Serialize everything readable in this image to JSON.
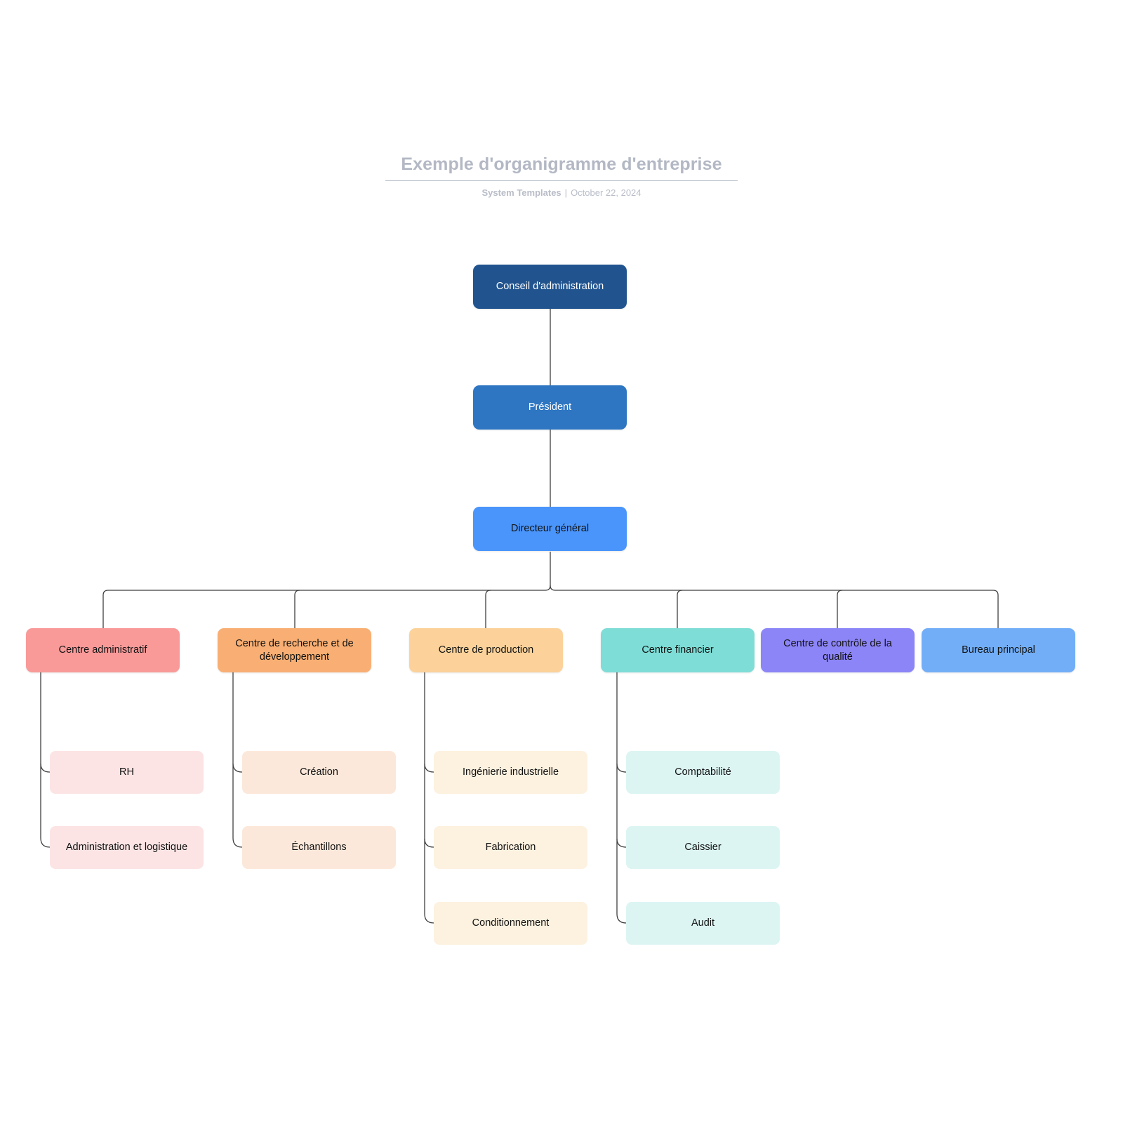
{
  "header": {
    "title": "Exemple d'organigramme d'entreprise",
    "author": "System Templates",
    "separator": "|",
    "date": "October 22, 2024"
  },
  "chart_data": {
    "type": "diagram",
    "diagram_kind": "organizational-chart",
    "title": "Exemple d'organigramme d'entreprise",
    "language": "fr",
    "levels": 4,
    "node_count": 18
  },
  "nodes": {
    "board": {
      "label": "Conseil d'administration",
      "color": "#21548F",
      "text_color": "#ffffff"
    },
    "president": {
      "label": "Président",
      "color": "#2E76C2",
      "text_color": "#ffffff"
    },
    "ceo": {
      "label": "Directeur général",
      "color": "#4A95FB",
      "text_color": "#111111"
    },
    "admin": {
      "label": "Centre administratif",
      "color": "#F99A99",
      "text_color": "#111111"
    },
    "rnd": {
      "label": "Centre de recherche et de développement",
      "color": "#F9AF73",
      "text_color": "#111111"
    },
    "production": {
      "label": "Centre de production",
      "color": "#FCD29A",
      "text_color": "#111111"
    },
    "finance": {
      "label": "Centre financier",
      "color": "#7EDDD6",
      "text_color": "#111111"
    },
    "quality": {
      "label": "Centre de contrôle de la qualité",
      "color": "#8C85F8",
      "text_color": "#111111"
    },
    "mainoffice": {
      "label": "Bureau principal",
      "color": "#72AEF8",
      "text_color": "#111111"
    },
    "hr": {
      "label": "RH",
      "color": "#FCE4E4",
      "text_color": "#111111"
    },
    "adminlog": {
      "label": "Administration et logistique",
      "color": "#FCE4E4",
      "text_color": "#111111"
    },
    "creation": {
      "label": "Création",
      "color": "#FCE8DA",
      "text_color": "#111111"
    },
    "samples": {
      "label": "Échantillons",
      "color": "#FCE8DA",
      "text_color": "#111111"
    },
    "indeng": {
      "label": "Ingénierie industrielle",
      "color": "#FDF1DF",
      "text_color": "#111111"
    },
    "manufacture": {
      "label": "Fabrication",
      "color": "#FDF1DF",
      "text_color": "#111111"
    },
    "packaging": {
      "label": "Conditionnement",
      "color": "#FDF1DF",
      "text_color": "#111111"
    },
    "accounting": {
      "label": "Comptabilité",
      "color": "#DCF5F3",
      "text_color": "#111111"
    },
    "cashier": {
      "label": "Caissier",
      "color": "#DCF5F3",
      "text_color": "#111111"
    },
    "audit": {
      "label": "Audit",
      "color": "#DCF5F3",
      "text_color": "#111111"
    }
  },
  "connector_color": "#3f3f3f"
}
